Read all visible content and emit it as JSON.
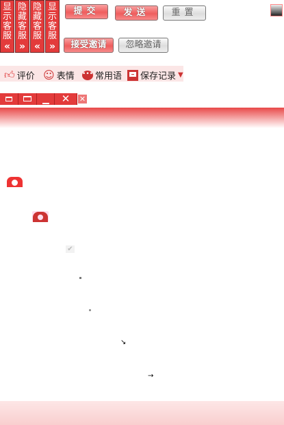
{
  "side_tabs": [
    {
      "text": "显示客服",
      "arrow": "«"
    },
    {
      "text": "隐藏客服",
      "arrow": "»"
    },
    {
      "text": "隐藏客服",
      "arrow": "«"
    },
    {
      "text": "显示客服",
      "arrow": "»"
    }
  ],
  "buttons": {
    "submit": "提交",
    "send": "发送",
    "reset": "重置",
    "accept": "接受邀请",
    "ignore": "忽略邀请"
  },
  "toolbar": {
    "rate": "评价",
    "emoji": "表情",
    "phrases": "常用语",
    "save": "保存记录"
  },
  "glyphs": {
    "arrow_se": "↘",
    "arrow_right": "→"
  },
  "colors": {
    "accent": "#e33b3b",
    "toolbar_bg": "#fbe6e6"
  }
}
